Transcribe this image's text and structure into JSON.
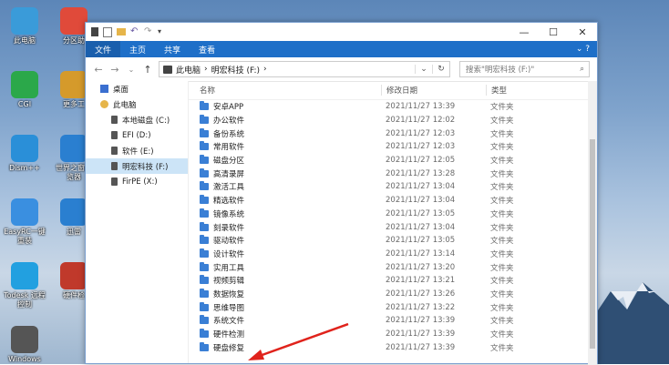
{
  "desktop": {
    "icons": [
      {
        "label": "此电脑",
        "color": "#3a9bd9"
      },
      {
        "label": "分区助",
        "color": "#e04a3a"
      },
      {
        "label": "CGI",
        "color": "#2ba84a"
      },
      {
        "label": "更多工",
        "color": "#d59a2b"
      },
      {
        "label": "Dism++",
        "color": "#2a8fd8"
      },
      {
        "label": "世界之窗浏览器",
        "color": "#2a7fd0"
      },
      {
        "label": "EasyRC一键重装",
        "color": "#3a8fe0"
      },
      {
        "label": "迅雷",
        "color": "#2a7fd0"
      },
      {
        "label": "Todesk 远程控制",
        "color": "#22a0e0"
      },
      {
        "label": "硬件检",
        "color": "#c0392b"
      },
      {
        "label": "Windows",
        "color": "#555555"
      }
    ]
  },
  "window": {
    "ribbon_tabs": [
      "文件",
      "主页",
      "共享",
      "查看"
    ],
    "controls": {
      "minimize": "—",
      "maximize": "☐",
      "close": "✕"
    },
    "address_segments": [
      "此电脑",
      "›",
      "明宏科技 (F:)",
      "›"
    ],
    "search_placeholder": "搜索\"明宏科技 (F:)\""
  },
  "tree": [
    {
      "label": "桌面",
      "kind": "desktop",
      "indent": 1
    },
    {
      "label": "此电脑",
      "kind": "pc",
      "indent": 1
    },
    {
      "label": "本地磁盘 (C:)",
      "kind": "drive",
      "indent": 2
    },
    {
      "label": "EFI (D:)",
      "kind": "drive",
      "indent": 2
    },
    {
      "label": "软件 (E:)",
      "kind": "drive",
      "indent": 2
    },
    {
      "label": "明宏科技 (F:)",
      "kind": "drive",
      "indent": 2,
      "selected": true
    },
    {
      "label": "FirPE (X:)",
      "kind": "drive",
      "indent": 2
    }
  ],
  "columns": {
    "name": "名称",
    "date": "修改日期",
    "type": "类型"
  },
  "files": [
    {
      "name": "安卓APP",
      "date": "2021/11/27 13:39",
      "type": "文件夹"
    },
    {
      "name": "办公软件",
      "date": "2021/11/27 12:02",
      "type": "文件夹"
    },
    {
      "name": "备份系统",
      "date": "2021/11/27 12:03",
      "type": "文件夹"
    },
    {
      "name": "常用软件",
      "date": "2021/11/27 12:03",
      "type": "文件夹"
    },
    {
      "name": "磁盘分区",
      "date": "2021/11/27 12:05",
      "type": "文件夹"
    },
    {
      "name": "高清录屏",
      "date": "2021/11/27 13:28",
      "type": "文件夹"
    },
    {
      "name": "激活工具",
      "date": "2021/11/27 13:04",
      "type": "文件夹"
    },
    {
      "name": "精选软件",
      "date": "2021/11/27 13:04",
      "type": "文件夹"
    },
    {
      "name": "镜像系统",
      "date": "2021/11/27 13:05",
      "type": "文件夹"
    },
    {
      "name": "刻录软件",
      "date": "2021/11/27 13:04",
      "type": "文件夹"
    },
    {
      "name": "驱动软件",
      "date": "2021/11/27 13:05",
      "type": "文件夹"
    },
    {
      "name": "设计软件",
      "date": "2021/11/27 13:14",
      "type": "文件夹"
    },
    {
      "name": "实用工具",
      "date": "2021/11/27 13:20",
      "type": "文件夹"
    },
    {
      "name": "视频剪辑",
      "date": "2021/11/27 13:21",
      "type": "文件夹"
    },
    {
      "name": "数据恢复",
      "date": "2021/11/27 13:26",
      "type": "文件夹"
    },
    {
      "name": "思维导图",
      "date": "2021/11/27 13:22",
      "type": "文件夹"
    },
    {
      "name": "系统文件",
      "date": "2021/11/27 13:39",
      "type": "文件夹"
    },
    {
      "name": "硬件检测",
      "date": "2021/11/27 13:39",
      "type": "文件夹"
    },
    {
      "name": "硬盘修复",
      "date": "2021/11/27 13:39",
      "type": "文件夹"
    }
  ],
  "colors": {
    "ribbon": "#1e6fc8",
    "folder": "#3a7fd5",
    "selection": "#cce4f7",
    "annotation_arrow": "#e0231c"
  }
}
